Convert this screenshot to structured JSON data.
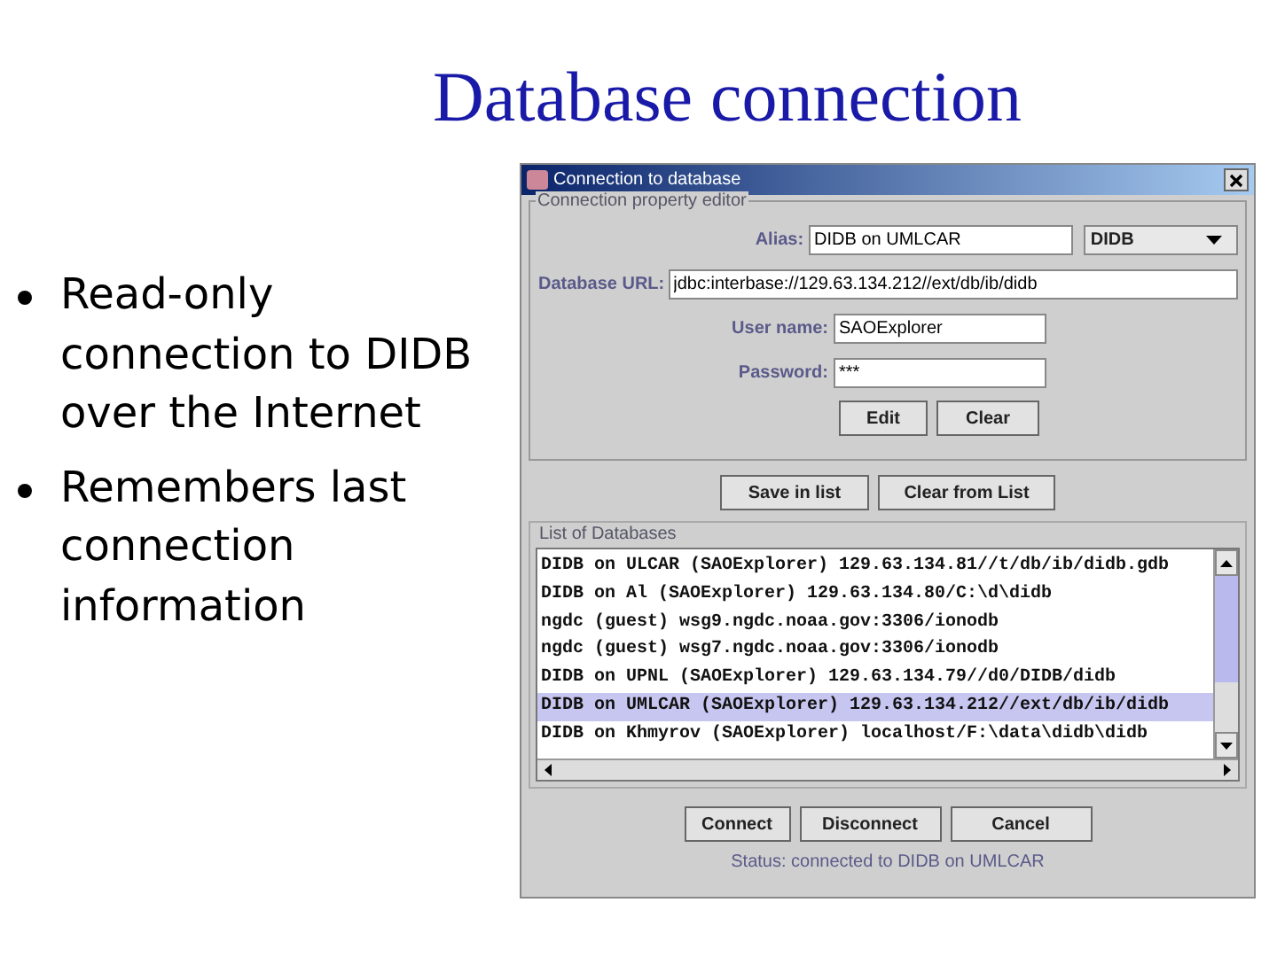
{
  "slide_title": "Database connection",
  "bullets": [
    "Read-only connection to DIDB over the Internet",
    "Remembers last connection information"
  ],
  "window": {
    "title": "Connection to database",
    "editor": {
      "legend": "Connection property editor",
      "alias": {
        "label": "Alias:",
        "value": "DIDB on UMLCAR"
      },
      "type_dropdown": "DIDB",
      "url": {
        "label": "Database URL:",
        "value": "jdbc:interbase://129.63.134.212//ext/db/ib/didb"
      },
      "user": {
        "label": "User name:",
        "value": "SAOExplorer"
      },
      "password": {
        "label": "Password:",
        "value": "***"
      },
      "buttons": [
        "Edit",
        "Clear"
      ]
    },
    "list_buttons": [
      "Save in list",
      "Clear from List"
    ],
    "list": {
      "legend": "List of Databases",
      "items": [
        {
          "text": "DIDB on ULCAR (SAOExplorer) 129.63.134.81//t/db/ib/didb.gdb",
          "selected": false
        },
        {
          "text": "DIDB on Al (SAOExplorer) 129.63.134.80/C:\\d\\didb",
          "selected": false
        },
        {
          "text": "ngdc (guest) wsg9.ngdc.noaa.gov:3306/ionodb",
          "selected": false
        },
        {
          "text": "ngdc (guest) wsg7.ngdc.noaa.gov:3306/ionodb",
          "selected": false
        },
        {
          "text": "DIDB on UPNL (SAOExplorer) 129.63.134.79//d0/DIDB/didb",
          "selected": false
        },
        {
          "text": "DIDB on UMLCAR (SAOExplorer) 129.63.134.212//ext/db/ib/didb",
          "selected": true
        },
        {
          "text": "DIDB on Khmyrov (SAOExplorer) localhost/F:\\data\\didb\\didb",
          "selected": false
        }
      ]
    },
    "buttons": [
      "Connect",
      "Disconnect",
      "Cancel"
    ],
    "status": "Status: connected to DIDB on UMLCAR"
  }
}
